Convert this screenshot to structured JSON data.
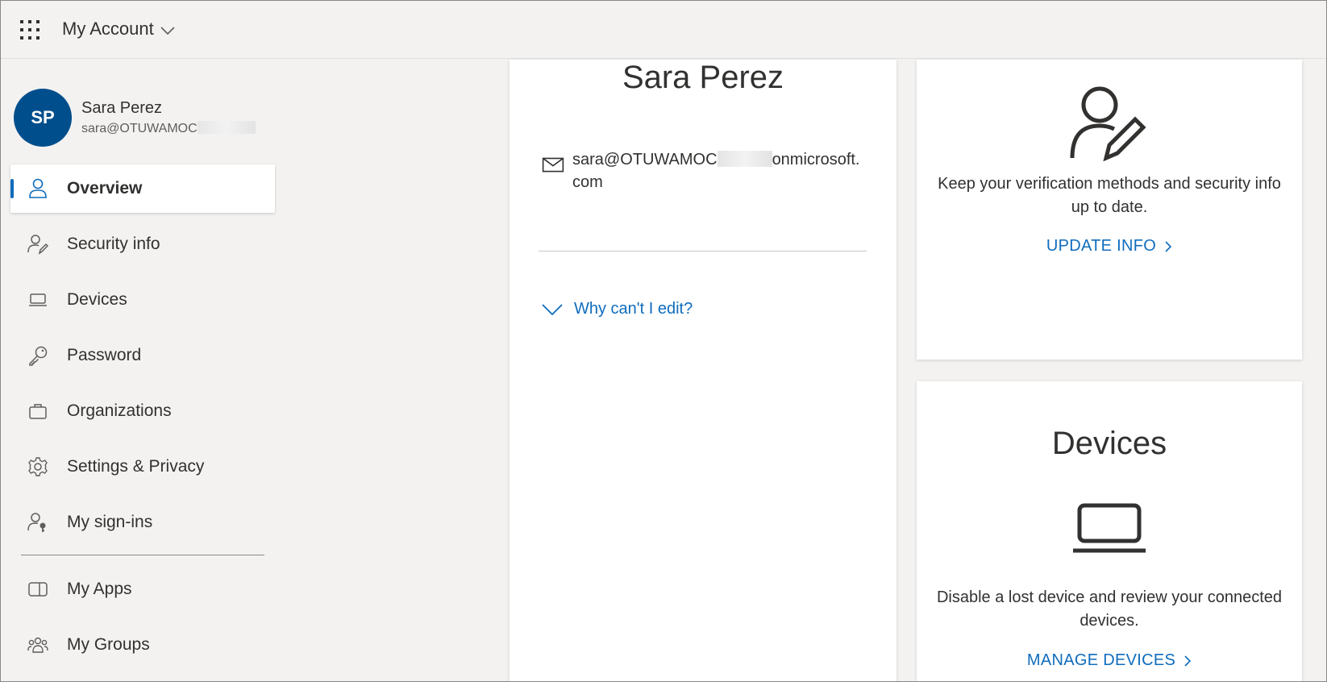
{
  "header": {
    "app_title": "My Account",
    "waffle_icon": "app-launcher-icon",
    "title_chevron_icon": "chevron-down-icon"
  },
  "profile": {
    "initials": "SP",
    "name": "Sara Perez",
    "email_prefix": "sara@OTUWAMOC",
    "avatar_color": "#004e8c"
  },
  "nav": {
    "items": [
      {
        "label": "Overview",
        "icon": "person-icon",
        "active": true
      },
      {
        "label": "Security info",
        "icon": "person-edit-icon"
      },
      {
        "label": "Devices",
        "icon": "laptop-icon"
      },
      {
        "label": "Password",
        "icon": "key-icon"
      },
      {
        "label": "Organizations",
        "icon": "briefcase-icon"
      },
      {
        "label": "Settings & Privacy",
        "icon": "gear-icon"
      },
      {
        "label": "My sign-ins",
        "icon": "person-key-icon"
      }
    ],
    "apps_items": [
      {
        "label": "My Apps",
        "icon": "apps-icon"
      },
      {
        "label": "My Groups",
        "icon": "groups-icon"
      }
    ],
    "accent_color": "#0f6cbd"
  },
  "profile_card": {
    "name": "Sara Perez",
    "email_prefix": "sara@OTUWAMOC",
    "email_suffix": "onmicrosoft.",
    "email_tail": "com",
    "why_edit_label": "Why can't I edit?"
  },
  "security_card": {
    "description": "Keep your verification methods and security info up to date.",
    "link_label": "UPDATE INFO"
  },
  "devices_card": {
    "title": "Devices",
    "description": "Disable a lost device and review your connected devices.",
    "link_label": "MANAGE DEVICES"
  },
  "link_color": "#0f6cbd"
}
